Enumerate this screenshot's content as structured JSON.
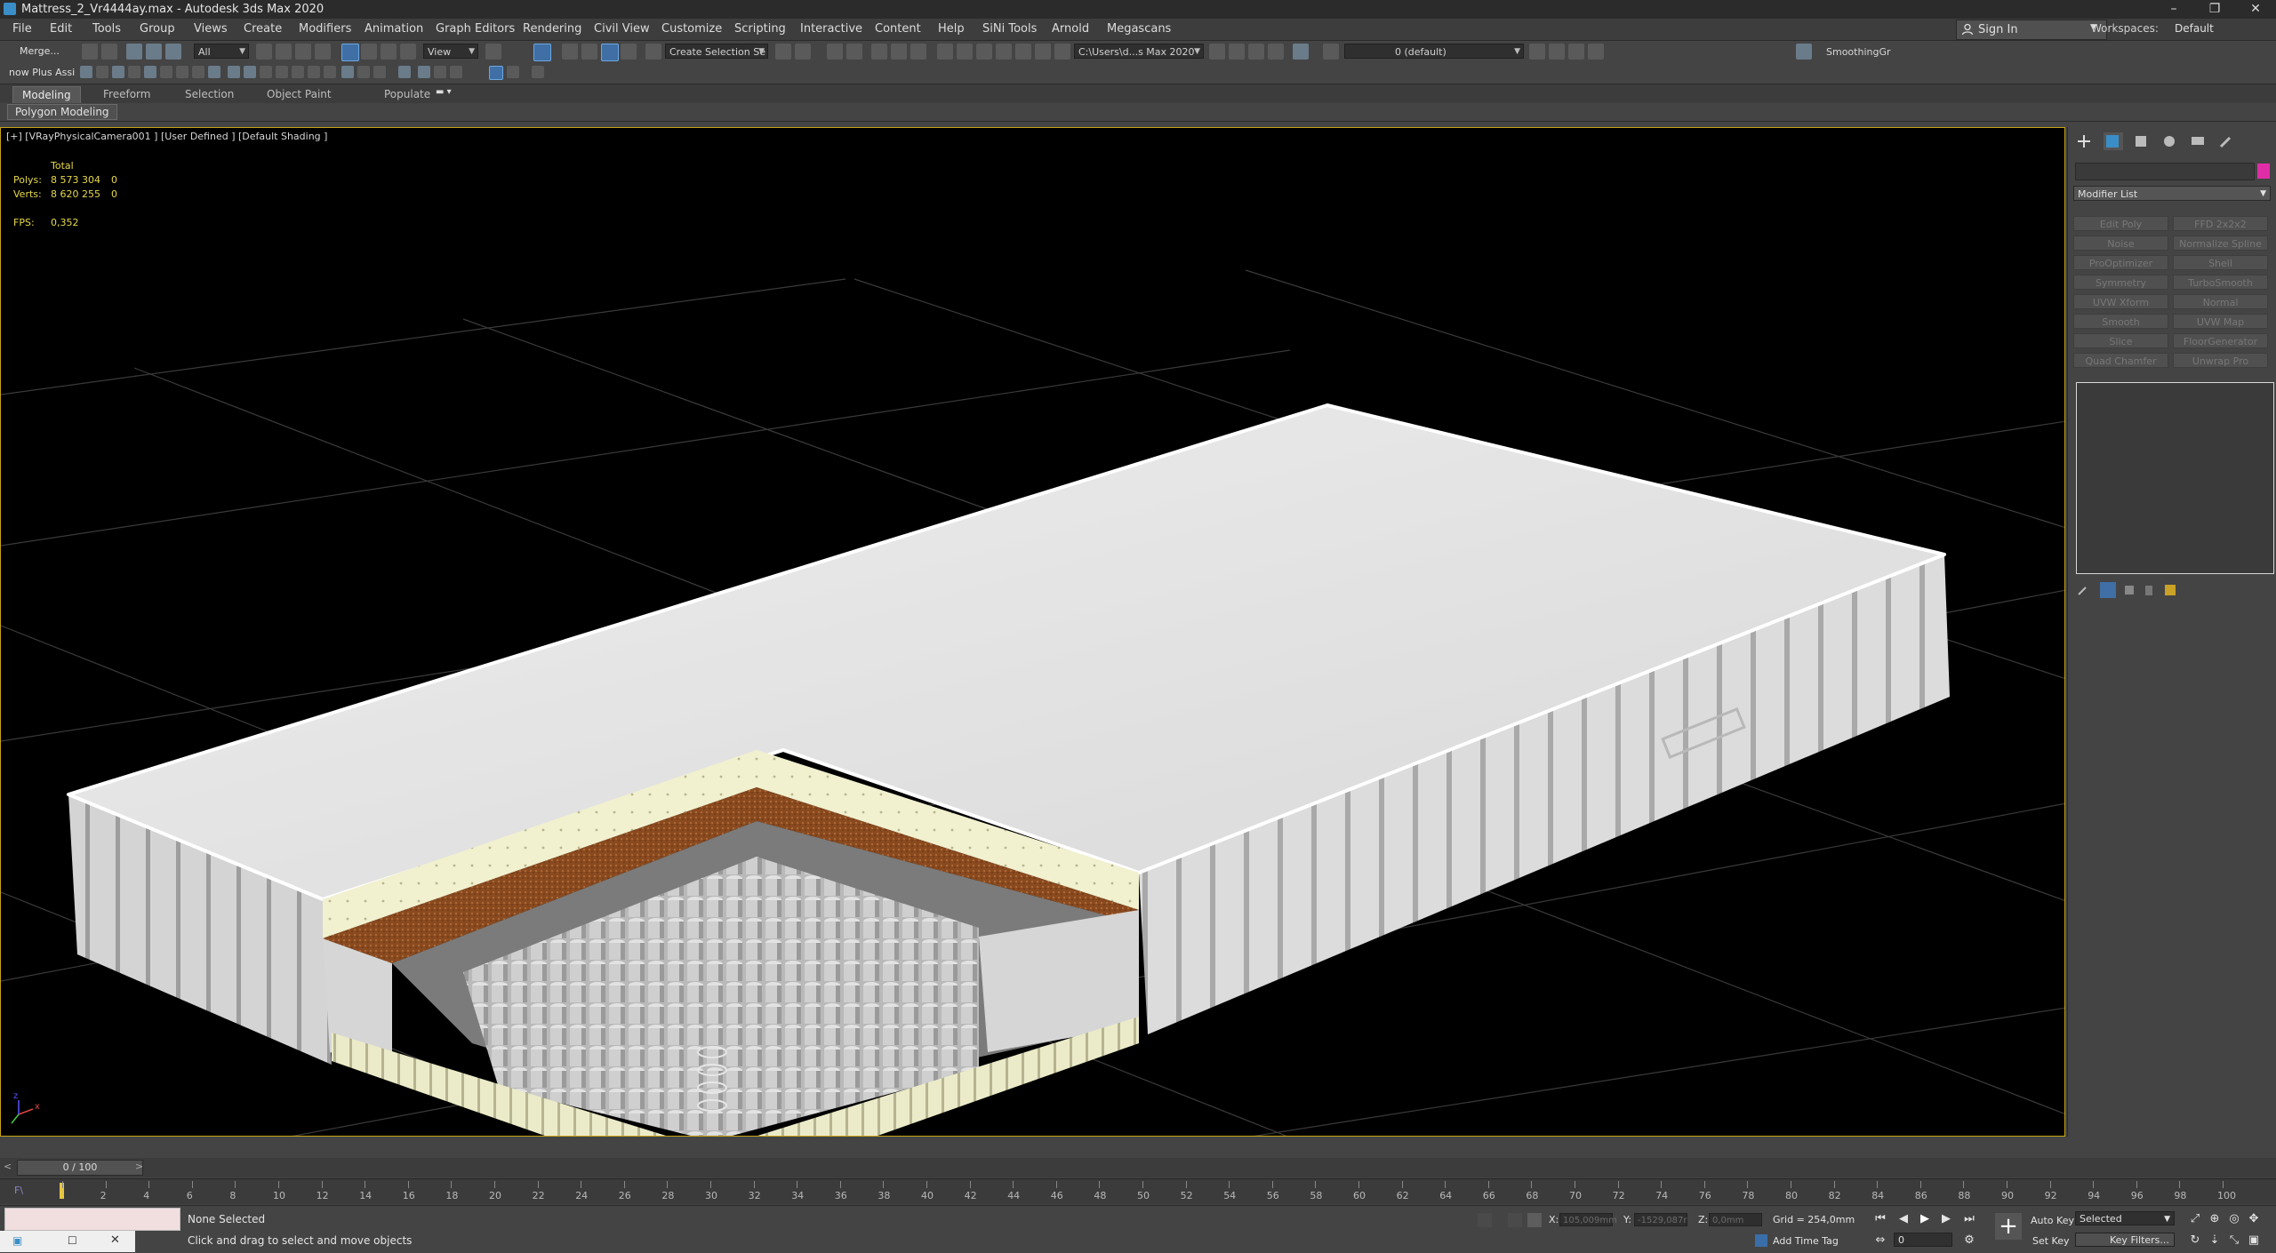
{
  "window": {
    "title": "Mattress_2_Vr4444ay.max - Autodesk 3ds Max 2020",
    "minimize": "–",
    "maximize": "❐",
    "close": "✕"
  },
  "menubar": {
    "items": [
      "File",
      "Edit",
      "Tools",
      "Group",
      "Views",
      "Create",
      "Modifiers",
      "Animation",
      "Graph Editors",
      "Rendering",
      "Civil View",
      "Customize",
      "Scripting",
      "Interactive",
      "Content",
      "Help",
      "SiNi Tools",
      "Arnold",
      "Megascans"
    ],
    "sign_in": "Sign In",
    "workspaces_label": "Workspaces:",
    "workspaces_value": "Default"
  },
  "toolbar": {
    "merge_label": "Merge...",
    "selection_filter": "All",
    "reference_coord": "View",
    "named_selection": "Create Selection Se",
    "project_path": "C:\\Users\\d...s Max 2020",
    "layer": "0 (default)",
    "smoothing_label": "SmoothingGr",
    "row2_label": "now Plus Assi"
  },
  "ribbon": {
    "tabs": [
      "Modeling",
      "Freeform",
      "Selection",
      "Object Paint",
      "Populate"
    ],
    "active_tab": "Modeling",
    "subpanel": "Polygon Modeling"
  },
  "viewport": {
    "label": "[+] [VRayPhysicalCamera001 ] [User Defined ] [Default Shading ]",
    "stats_total": "Total",
    "polys_label": "Polys:",
    "polys_value": "8 573 304",
    "polys_sel": "0",
    "verts_label": "Verts:",
    "verts_value": "8 620 255",
    "verts_sel": "0",
    "fps_label": "FPS:",
    "fps_value": "0,352",
    "axis_x": "x",
    "axis_z": "z"
  },
  "command_panel": {
    "modifier_list": "Modifier List",
    "modifiers": [
      "Edit Poly",
      "FFD 2x2x2",
      "Noise",
      "Normalize Spline",
      "ProOptimizer",
      "Shell",
      "Symmetry",
      "TurboSmooth",
      "UVW Xform",
      "Normal",
      "Smooth",
      "UVW Map",
      "Slice",
      "FloorGenerator",
      "Quad Chamfer",
      "Unwrap Pro"
    ]
  },
  "timeline": {
    "frame": "0 / 100",
    "ticks": [
      "0",
      "2",
      "4",
      "6",
      "8",
      "10",
      "12",
      "14",
      "16",
      "18",
      "20",
      "22",
      "24",
      "26",
      "28",
      "30",
      "32",
      "34",
      "36",
      "38",
      "40",
      "42",
      "44",
      "46",
      "48",
      "50",
      "52",
      "54",
      "56",
      "58",
      "60",
      "62",
      "64",
      "66",
      "68",
      "70",
      "72",
      "74",
      "76",
      "78",
      "80",
      "82",
      "84",
      "86",
      "88",
      "90",
      "92",
      "94",
      "96",
      "98",
      "100"
    ]
  },
  "status": {
    "selection": "None Selected",
    "prompt": "Click and drag to select and move objects",
    "x_label": "X:",
    "x_value": "105,009mm",
    "y_label": "Y:",
    "y_value": "-1529,087r",
    "z_label": "Z:",
    "z_value": "0,0mm",
    "grid": "Grid = 254,0mm",
    "add_time_tag": "Add Time Tag",
    "auto_key": "Auto Key",
    "set_key": "Set Key",
    "selected": "Selected",
    "key_filters": "Key Filters...",
    "frame_value": "0"
  },
  "colors": {
    "viewport_border": "#c7a41a",
    "stats": "#e6d84a",
    "object_color": "#e02da7"
  }
}
